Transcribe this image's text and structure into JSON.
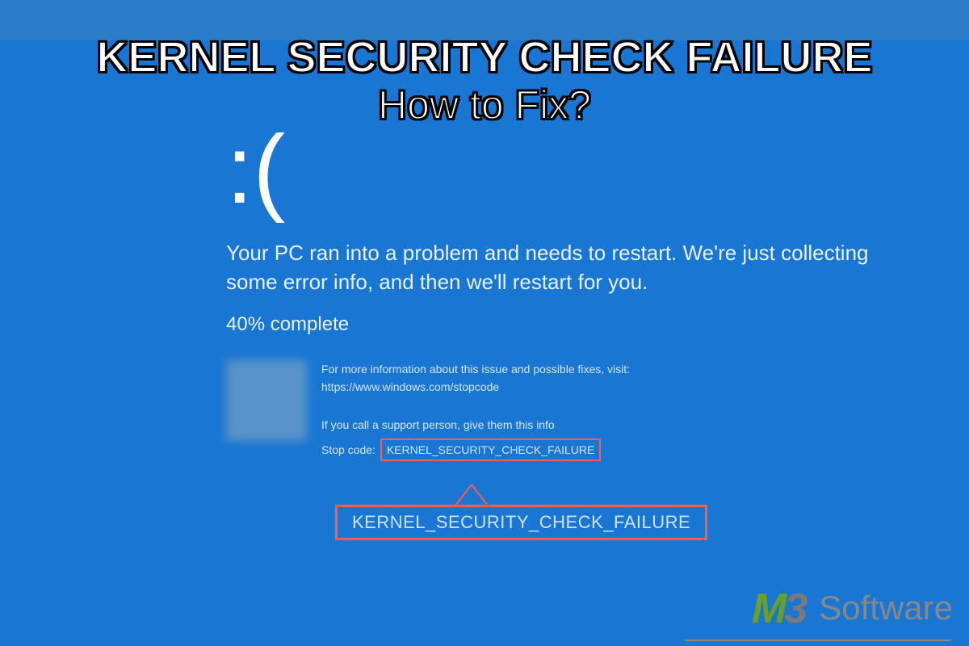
{
  "overlay": {
    "line1": "KERNEL SECURITY CHECK FAILURE",
    "line2": "How to Fix?"
  },
  "bsod": {
    "sad_face": ":(",
    "message": "Your PC ran into a problem and needs to restart. We're just collecting some error info, and then we'll restart for you.",
    "progress": "40% complete",
    "more_info": "For more information about this issue and possible fixes, visit: https://www.windows.com/stopcode",
    "support_line": "If you call a support person, give them this info",
    "stopcode_label": "Stop code:",
    "stopcode_value": "KERNEL_SECURITY_CHECK_FAILURE"
  },
  "magnified": "KERNEL_SECURITY_CHECK_FAILURE",
  "logo": {
    "m": "M",
    "three": "3",
    "word": "Software"
  }
}
